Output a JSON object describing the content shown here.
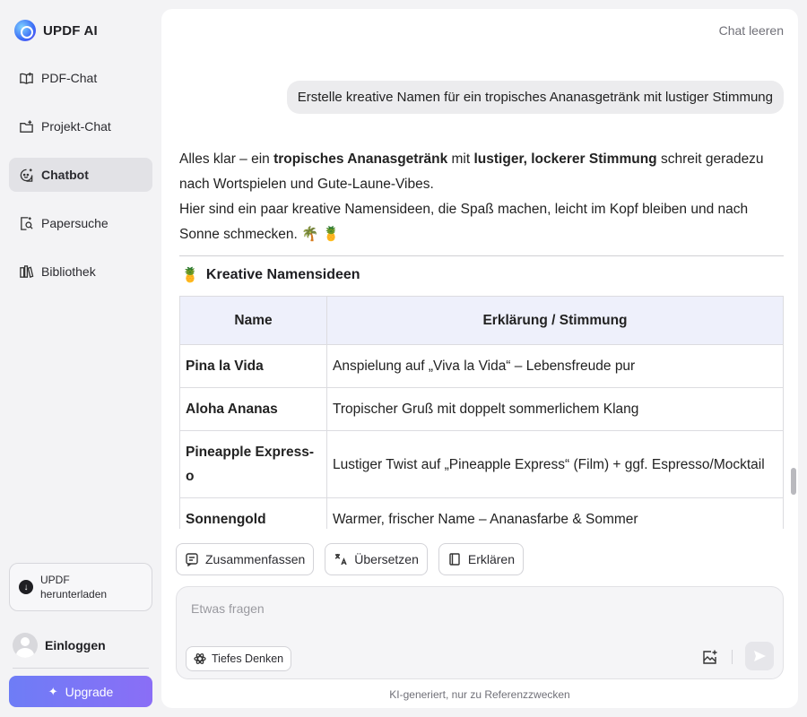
{
  "brand": {
    "name": "UPDF AI"
  },
  "sidebar": {
    "items": [
      {
        "label": "PDF-Chat",
        "icon": "book-open-icon",
        "active": false
      },
      {
        "label": "Projekt-Chat",
        "icon": "folder-plus-icon",
        "active": false
      },
      {
        "label": "Chatbot",
        "icon": "chatbot-icon",
        "active": true
      },
      {
        "label": "Papersuche",
        "icon": "paper-search-icon",
        "active": false
      },
      {
        "label": "Bibliothek",
        "icon": "library-icon",
        "active": false
      }
    ],
    "download_label": "UPDF herunterladen",
    "login_label": "Einloggen",
    "upgrade_label": "Upgrade"
  },
  "header": {
    "clear_chat": "Chat leeren"
  },
  "chat": {
    "user_message": "Erstelle kreative Namen für ein tropisches Ananasgetränk mit lustiger Stimmung",
    "answer": {
      "p1_a": "Alles klar – ein ",
      "p1_b": "tropisches Ananasgetränk",
      "p1_c": " mit ",
      "p1_d": "lustiger, lockerer Stimmung",
      "p1_e": " schreit geradezu nach Wortspielen und Gute-Laune-Vibes.",
      "p2": "Hier sind ein paar kreative Namensideen, die Spaß machen, leicht im Kopf bleiben und nach Sonne schmecken. 🌴 🍍"
    },
    "section_emoji": "🍍",
    "section_title": "Kreative Namensideen",
    "table": {
      "headers": [
        "Name",
        "Erklärung / Stimmung"
      ],
      "rows": [
        {
          "name": "Pina la Vida",
          "desc": "Anspielung auf „Viva la Vida“ – Lebensfreude pur"
        },
        {
          "name": "Aloha Ananas",
          "desc": "Tropischer Gruß mit doppelt sommerlichem Klang"
        },
        {
          "name": "Pineapple Express-o",
          "desc": "Lustiger Twist auf „Pineapple Express“ (Film) + ggf. Espresso/Mocktail"
        },
        {
          "name": "Sonnengold",
          "desc": "Warmer, frischer Name – Ananasfarbe & Sommer"
        }
      ]
    }
  },
  "actions": {
    "summarize": "Zusammenfassen",
    "translate": "Übersetzen",
    "explain": "Erklären"
  },
  "input": {
    "placeholder": "Etwas fragen",
    "deep_think": "Tiefes Denken"
  },
  "footer": {
    "note": "KI-generiert, nur zu Referenzzwecken"
  },
  "colors": {
    "upgrade_start": "#6e7df6",
    "upgrade_end": "#8a6ef6",
    "table_header_bg": "#eef0fb"
  }
}
